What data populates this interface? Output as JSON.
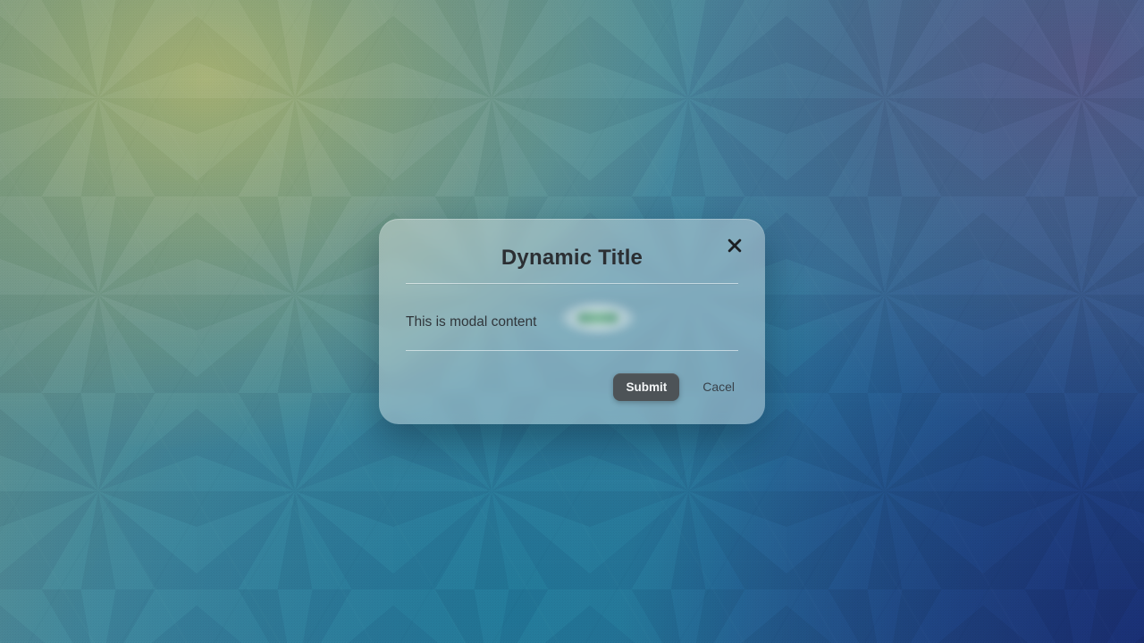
{
  "modal": {
    "title": "Dynamic Title",
    "body_text": "This is modal content",
    "submit_label": "Submit",
    "cancel_label": "Cacel",
    "close_icon": "close-icon"
  }
}
